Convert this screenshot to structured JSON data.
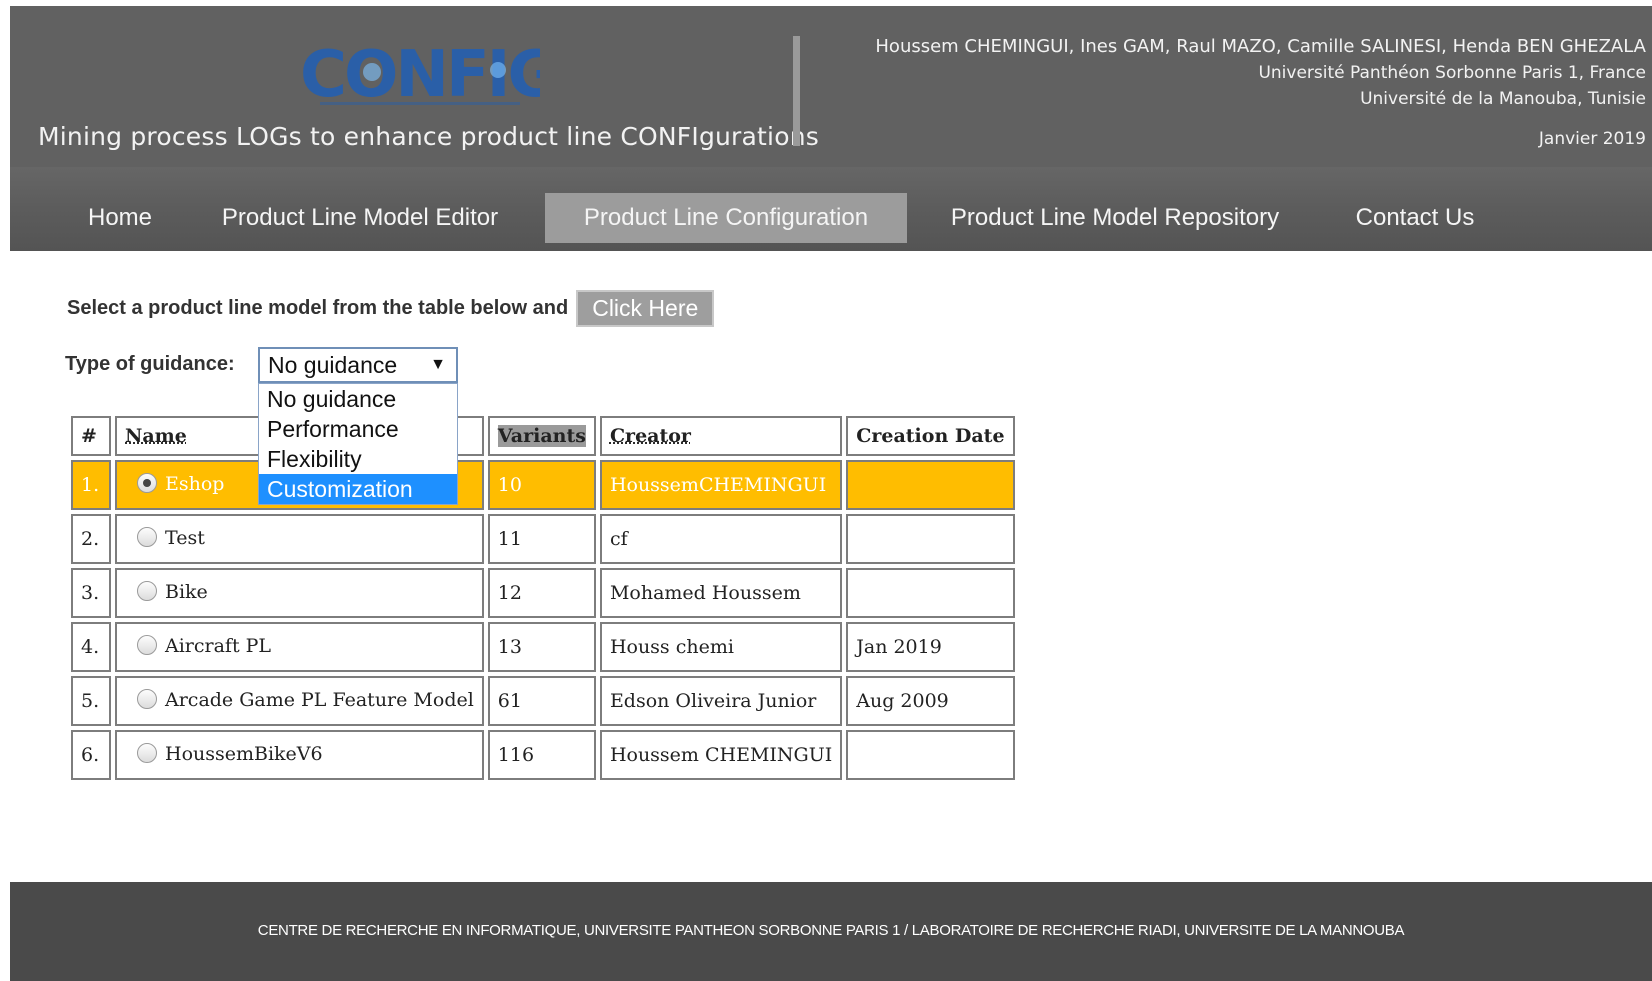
{
  "header": {
    "logo_text": "CONFIGLOG",
    "tagline": "Mining process LOGs to enhance product line CONFIgurations",
    "authors": "Houssem CHEMINGUI, Ines GAM, Raul MAZO, Camille SALINESI, Henda BEN GHEZALA",
    "affiliation1": "Université Panthéon Sorbonne Paris 1, France",
    "affiliation2": "Université de la Manouba, Tunisie",
    "date": "Janvier 2019"
  },
  "nav": {
    "items": [
      {
        "label": "Home"
      },
      {
        "label": "Product Line Model Editor"
      },
      {
        "label": "Product Line Configuration"
      },
      {
        "label": "Product Line Model Repository"
      },
      {
        "label": "Contact Us"
      }
    ],
    "active": "Product Line Configuration"
  },
  "main": {
    "select_text": "Select a product line model from the table below and",
    "click_button": "Click Here",
    "guidance_label": "Type of guidance:",
    "guidance_value": "No guidance",
    "guidance_options": [
      "No guidance",
      "Performance",
      "Flexibility",
      "Customization"
    ],
    "guidance_highlighted": "Customization"
  },
  "table": {
    "headers": {
      "num": "#",
      "name": "Name",
      "variants": "Variants",
      "creator": "Creator",
      "date": "Creation Date"
    },
    "rows": [
      {
        "num": "1.",
        "name": "Eshop",
        "variants": "10",
        "creator": "HoussemCHEMINGUI",
        "date": "",
        "selected": true
      },
      {
        "num": "2.",
        "name": "Test",
        "variants": "11",
        "creator": "cf",
        "date": ""
      },
      {
        "num": "3.",
        "name": "Bike",
        "variants": "12",
        "creator": "Mohamed Houssem",
        "date": ""
      },
      {
        "num": "4.",
        "name": "Aircraft PL",
        "variants": "13",
        "creator": "Houss chemi",
        "date": "Jan 2019"
      },
      {
        "num": "5.",
        "name": "Arcade Game PL Feature Model",
        "variants": "61",
        "creator": "Edson Oliveira Junior",
        "date": "Aug 2009"
      },
      {
        "num": "6.",
        "name": "HoussemBikeV6",
        "variants": "116",
        "creator": "Houssem CHEMINGUI",
        "date": ""
      }
    ]
  },
  "footer": {
    "text": "CENTRE DE RECHERCHE EN INFORMATIQUE, UNIVERSITE PANTHEON SORBONNE PARIS 1 / LABORATOIRE DE RECHERCHE RIADI, UNIVERSITE DE LA MANNOUBA"
  },
  "colors": {
    "header_bg": "#616161",
    "nav_active": "#9c9c9c",
    "selected_row": "#ffbd00",
    "logo_blue": "#2a5fa8",
    "footer_bg": "#4a4a4a"
  }
}
